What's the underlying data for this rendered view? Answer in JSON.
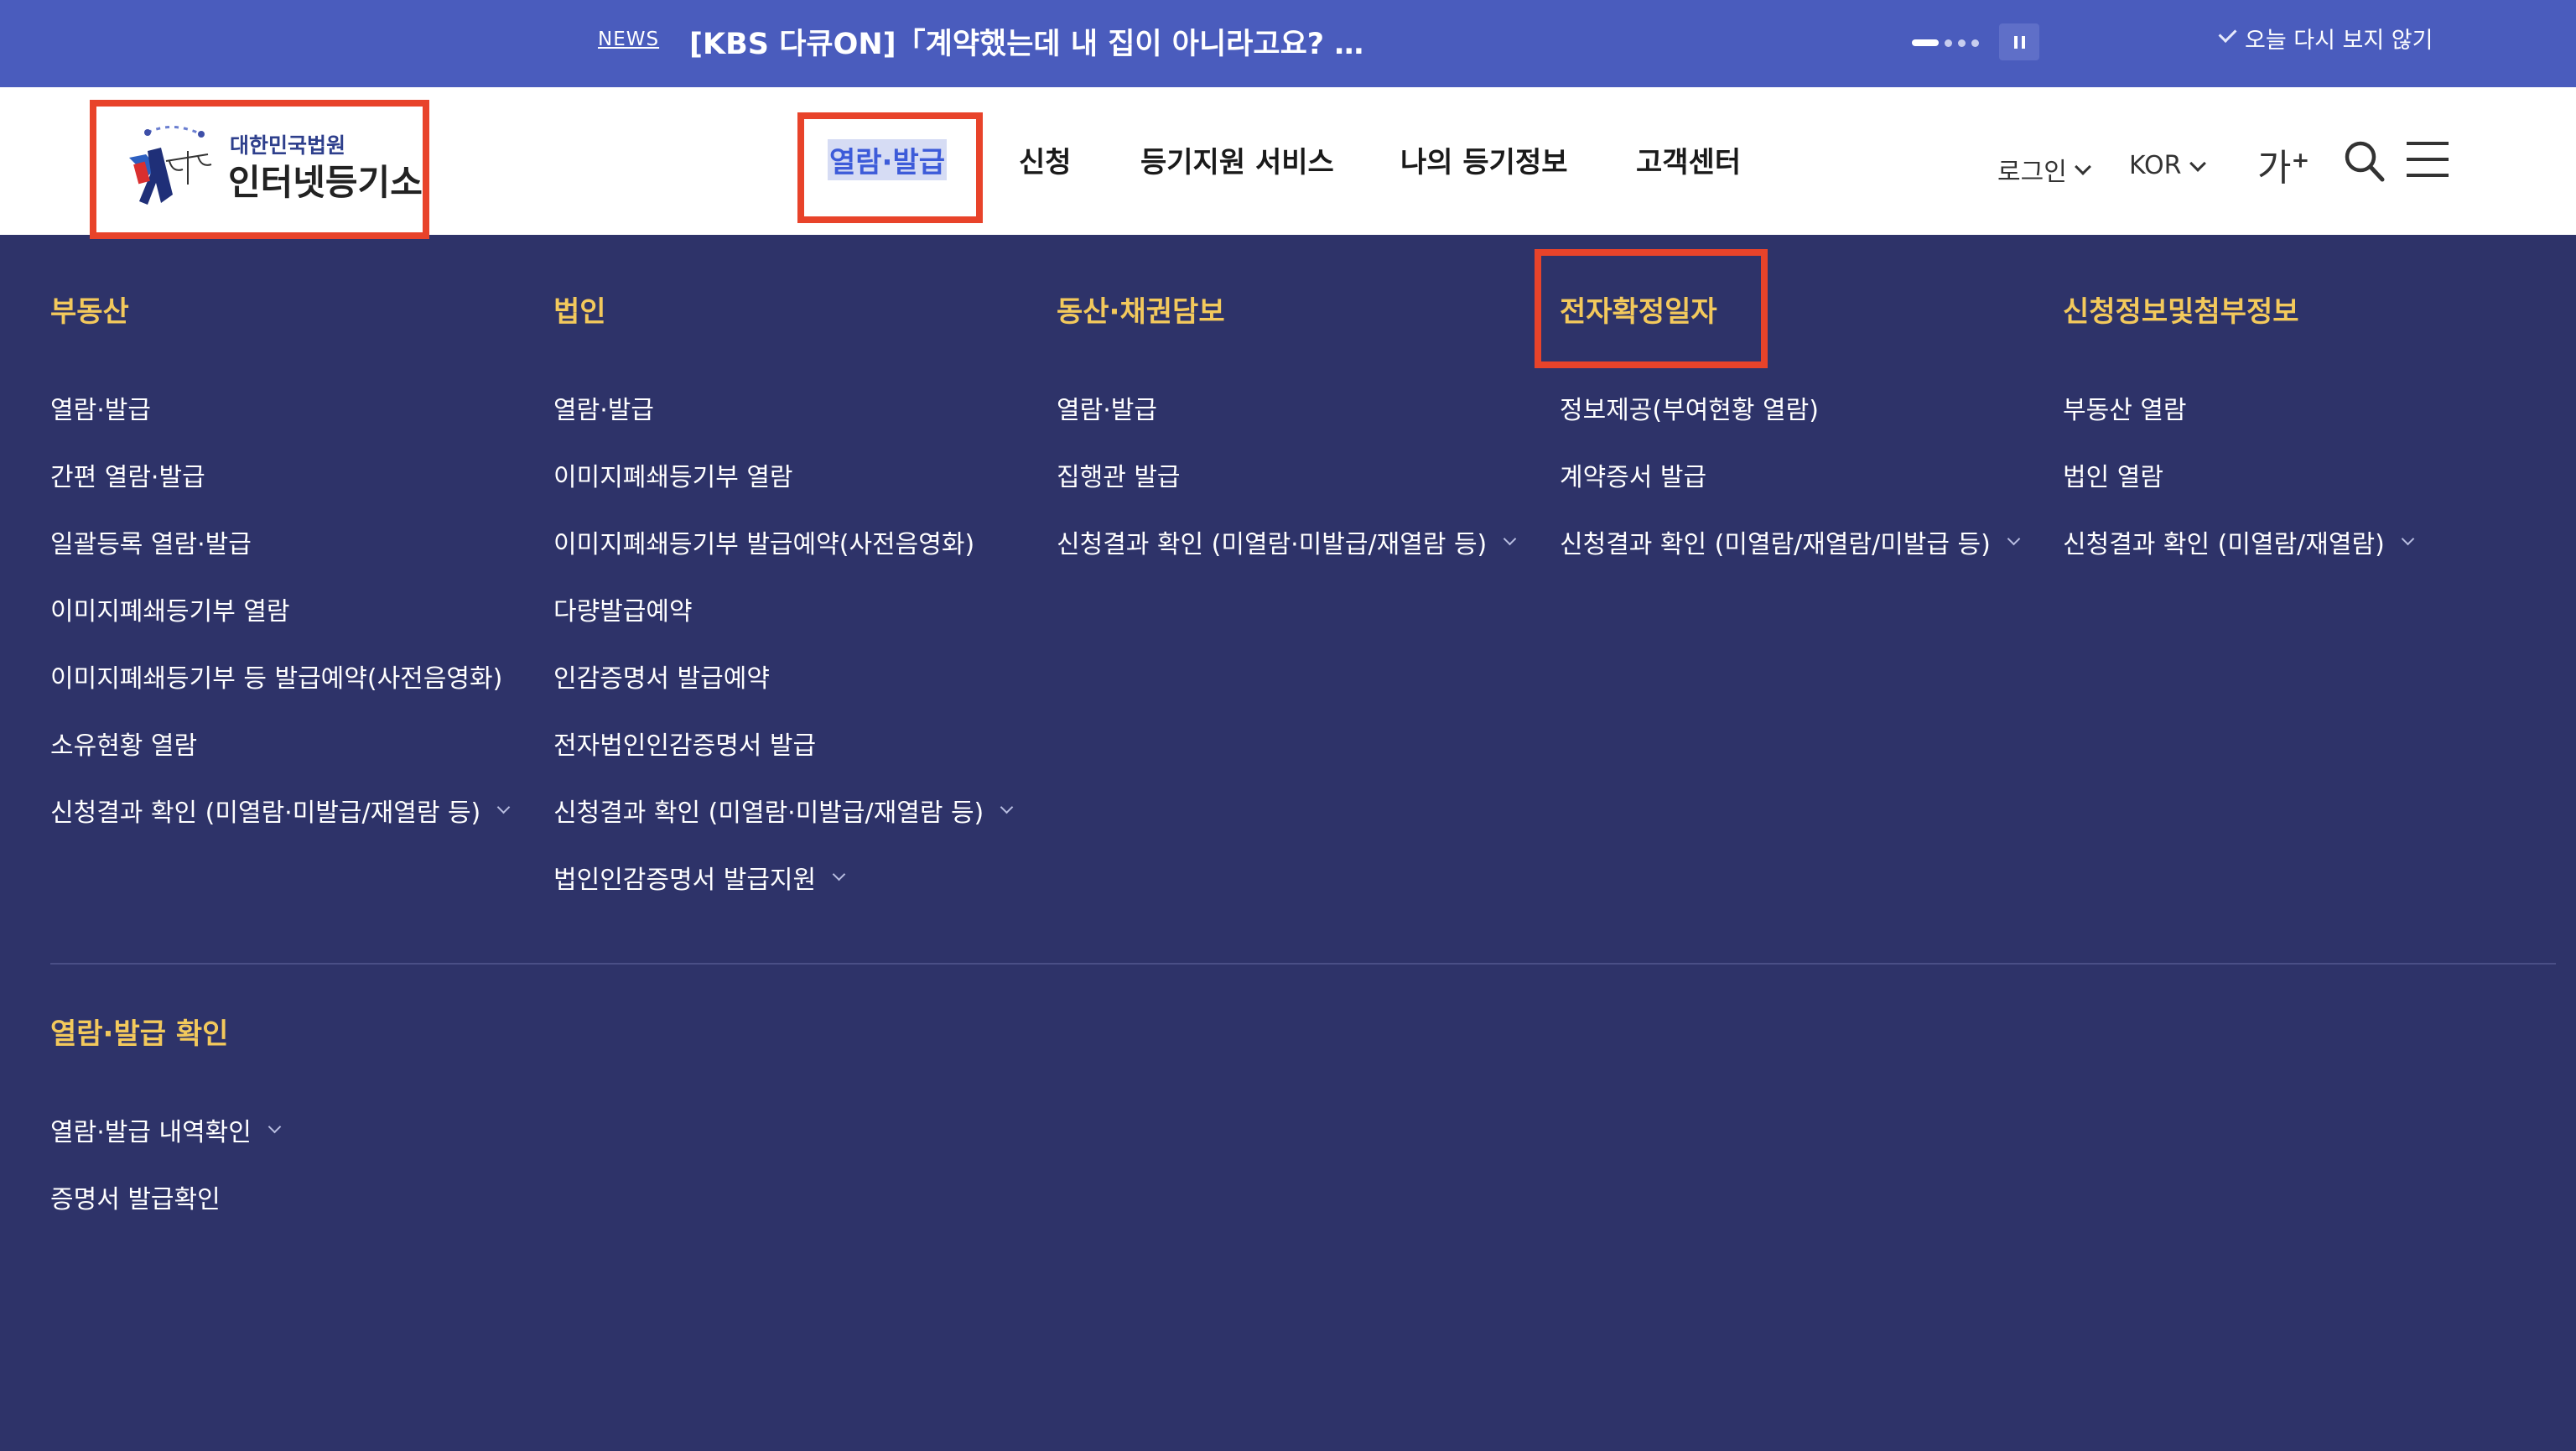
{
  "news": {
    "tag": "NEWS",
    "headline": "[KBS 다큐ON]「계약했는데 내 집이 아니라고요? …",
    "dismiss_label": "오늘 다시 보지 않기"
  },
  "logo": {
    "org": "대한민국법원",
    "name": "인터넷등기소"
  },
  "gnb": [
    {
      "label": "열람·발급"
    },
    {
      "label": "신청"
    },
    {
      "label": "등기지원 서비스"
    },
    {
      "label": "나의 등기정보"
    },
    {
      "label": "고객센터"
    }
  ],
  "utility": {
    "login": "로그인",
    "language": "KOR",
    "font_size": "가",
    "font_plus": "+"
  },
  "menu": {
    "columns": [
      {
        "title": "부동산",
        "items": [
          {
            "label": "열람·발급"
          },
          {
            "label": "간편 열람·발급"
          },
          {
            "label": "일괄등록 열람·발급"
          },
          {
            "label": "이미지폐쇄등기부 열람"
          },
          {
            "label": "이미지폐쇄등기부 등 발급예약(사전음영화)"
          },
          {
            "label": "소유현황 열람"
          },
          {
            "label": "신청결과 확인 (미열람·미발급/재열람 등)"
          }
        ]
      },
      {
        "title": "법인",
        "items": [
          {
            "label": "열람·발급"
          },
          {
            "label": "이미지폐쇄등기부 열람"
          },
          {
            "label": "이미지폐쇄등기부 발급예약(사전음영화)"
          },
          {
            "label": "다량발급예약"
          },
          {
            "label": "인감증명서 발급예약"
          },
          {
            "label": "전자법인인감증명서 발급"
          },
          {
            "label": "신청결과 확인 (미열람·미발급/재열람 등)"
          },
          {
            "label": "법인인감증명서 발급지원"
          }
        ]
      },
      {
        "title": "동산·채권담보",
        "items": [
          {
            "label": "열람·발급"
          },
          {
            "label": "집행관 발급"
          },
          {
            "label": "신청결과 확인 (미열람·미발급/재열람 등)"
          }
        ]
      },
      {
        "title": "전자확정일자",
        "items": [
          {
            "label": "정보제공(부여현황 열람)"
          },
          {
            "label": "계약증서 발급"
          },
          {
            "label": "신청결과 확인 (미열람/재열람/미발급 등)"
          }
        ]
      },
      {
        "title": "신청정보및첨부정보",
        "items": [
          {
            "label": "부동산 열람"
          },
          {
            "label": "법인 열람"
          },
          {
            "label": "신청결과 확인 (미열람/재열람)"
          }
        ]
      }
    ],
    "confirm_section": {
      "title": "열람·발급 확인",
      "items": [
        {
          "label": "열람·발급 내역확인"
        },
        {
          "label": "증명서 발급확인"
        }
      ]
    }
  },
  "colors": {
    "news_bar": "#4a5cbd",
    "menu_bg": "#2e3369",
    "menu_title": "#f3c95c",
    "highlight_box": "#e8432a",
    "active_tab": "#3d5bd9"
  }
}
